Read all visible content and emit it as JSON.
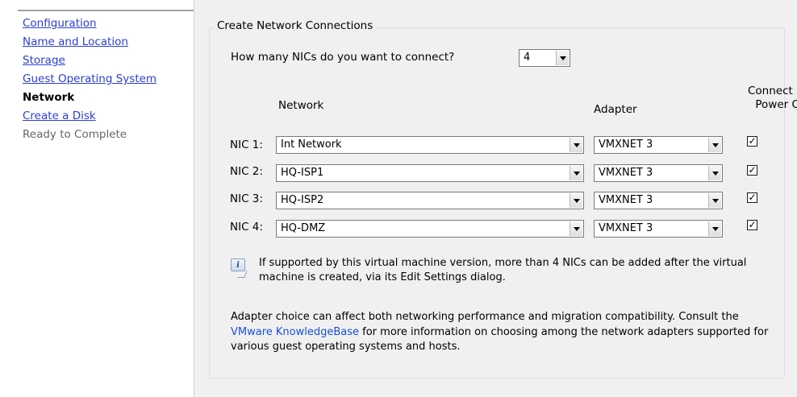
{
  "nav": {
    "items": [
      {
        "label": "Configuration",
        "state": "link"
      },
      {
        "label": "Name and Location",
        "state": "link"
      },
      {
        "label": "Storage",
        "state": "link"
      },
      {
        "label": "Guest Operating System",
        "state": "link"
      },
      {
        "label": "Network",
        "state": "current"
      },
      {
        "label": "Create a Disk",
        "state": "link"
      },
      {
        "label": "Ready to Complete",
        "state": "pending"
      }
    ]
  },
  "group": {
    "title": "Create Network Connections",
    "question": "How many NICs do you want to connect?",
    "nic_count": "4",
    "headers": {
      "network": "Network",
      "adapter": "Adapter",
      "power_line1": "Connect at",
      "power_line2": "Power On"
    },
    "nics": [
      {
        "label": "NIC 1:",
        "network": "Int Network",
        "adapter": "VMXNET 3",
        "connect": true
      },
      {
        "label": "NIC 2:",
        "network": "HQ-ISP1",
        "adapter": "VMXNET 3",
        "connect": true
      },
      {
        "label": "NIC 3:",
        "network": "HQ-ISP2",
        "adapter": "VMXNET 3",
        "connect": true
      },
      {
        "label": "NIC 4:",
        "network": "HQ-DMZ",
        "adapter": "VMXNET 3",
        "connect": true
      }
    ],
    "info_text": "If supported by this virtual machine version, more than 4 NICs can be added after the virtual machine is created, via its Edit Settings dialog.",
    "note_before": "Adapter choice can affect both networking performance and migration compatibility. Consult the ",
    "note_link": "VMware KnowledgeBase",
    "note_after": " for more information on choosing among the network adapters supported for various guest operating systems and hosts."
  },
  "icons": {
    "info": "info-icon",
    "dropdown": "chevron-down-icon",
    "check": "check-icon"
  },
  "colors": {
    "link": "#2b3ed4",
    "kb_link": "#1a4fd6",
    "panel_bg": "#f0f0f0"
  }
}
